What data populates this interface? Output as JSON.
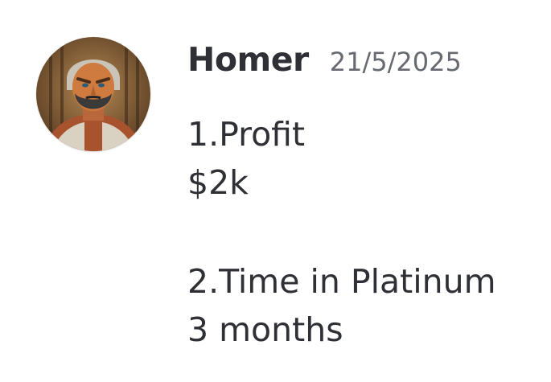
{
  "message": {
    "author": "Homer",
    "timestamp": "21/5/2025",
    "avatar_icon": "bearded-warrior-avatar",
    "lines": [
      "1.Profit",
      "$2k",
      "",
      "2.Time in Platinum",
      "3 months"
    ]
  },
  "colors": {
    "text": "#2e3035",
    "timestamp": "#686a72",
    "background": "#ffffff"
  }
}
